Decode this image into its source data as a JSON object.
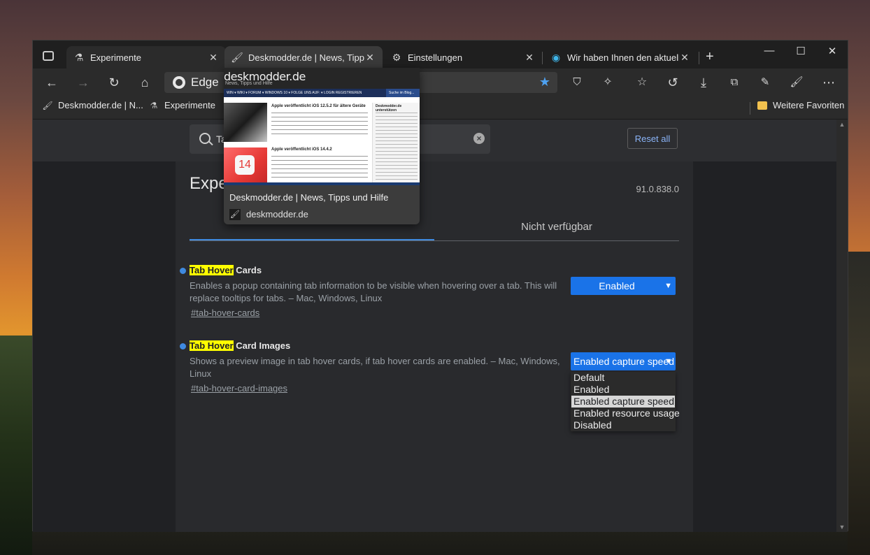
{
  "tabs": [
    {
      "label": "Experimente",
      "icon": "beaker-icon"
    },
    {
      "label": "Deskmodder.de | News, Tipps und Hilfe",
      "icon": "brush-icon"
    },
    {
      "label": "Einstellungen",
      "icon": "gear-icon"
    },
    {
      "label": "Wir haben Ihnen den aktuellen Edge",
      "icon": "edge-icon"
    }
  ],
  "window_controls": {
    "minimize": "—",
    "maximize": "☐",
    "close": "✕"
  },
  "address_bar": {
    "label": "Edge"
  },
  "bookmarks": [
    {
      "label": "Deskmodder.de | N..."
    },
    {
      "label": "Experimente"
    }
  ],
  "other_favorites": "Weitere Favoriten",
  "search": {
    "value": "Ta"
  },
  "reset_label": "Reset all",
  "page": {
    "title": "Expe",
    "version": "91.0.838.0",
    "tab_unavailable": "Nicht verfügbar"
  },
  "experiments": [
    {
      "title_highlight": "Tab Hover",
      "title_rest": " Cards",
      "description": "Enables a popup containing tab information to be visible when hovering over a tab. This will replace tooltips for tabs. – Mac, Windows, Linux",
      "link": "#tab-hover-cards",
      "selected": "Enabled"
    },
    {
      "title_highlight": "Tab Hover",
      "title_rest": " Card Images",
      "description": "Shows a preview image in tab hover cards, if tab hover cards are enabled. – Mac, Windows, Linux",
      "link": "#tab-hover-card-images",
      "selected": "Enabled capture speed",
      "options": [
        "Default",
        "Enabled",
        "Enabled capture speed",
        "Enabled resource usage",
        "Disabled"
      ]
    }
  ],
  "hover_card": {
    "title": "Deskmodder.de | News, Tipps und Hilfe",
    "domain": "deskmodder.de",
    "preview": {
      "logo": "deskmodder.de",
      "tagline": "News, Tipps und Hilfe",
      "nav": "WIN ▾   WIKI ▾   FORUM ▾   WINDOWS 10 ▾   FOLGE UNS AUF: ▾   LOGIN   REGISTRIEREN",
      "nav_search": "Suche im Blog...",
      "article1": "Apple veröffentlicht iOS 12.5.2 für ältere Geräte",
      "article2": "Apple veröffentlicht iOS 14.4.2",
      "thumb2_text": "14",
      "side_title": "Deskmodder.de unterstützen"
    }
  }
}
